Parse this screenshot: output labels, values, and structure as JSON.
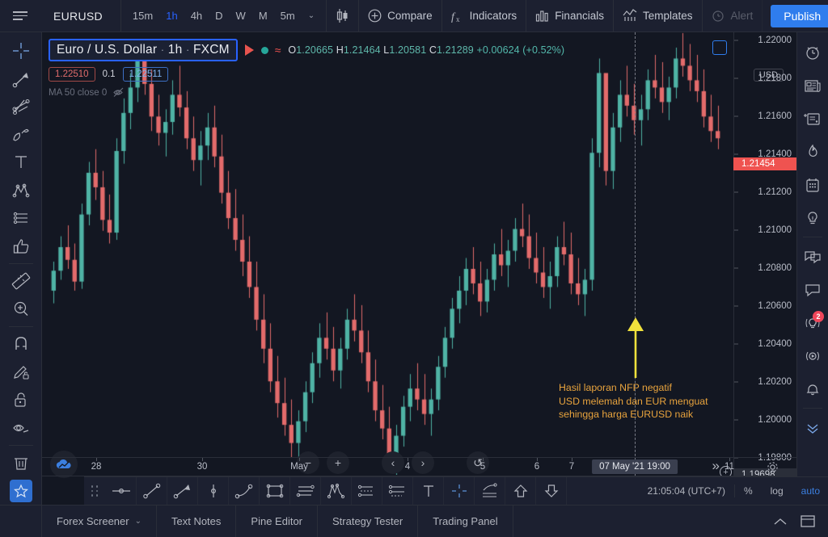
{
  "topbar": {
    "menu_icon": "hamburger-icon",
    "symbol": "EURUSD",
    "timeframes": [
      {
        "label": "15m",
        "active": false
      },
      {
        "label": "1h",
        "active": true
      },
      {
        "label": "4h",
        "active": false
      },
      {
        "label": "D",
        "active": false
      },
      {
        "label": "W",
        "active": false
      },
      {
        "label": "M",
        "active": false
      },
      {
        "label": "5m",
        "active": false
      }
    ],
    "caret": "⌄",
    "candle_style_icon": "candlestick-icon",
    "compare": "Compare",
    "indicators": "Indicators",
    "financials": "Financials",
    "templates": "Templates",
    "alert": "Alert",
    "publish": "Publish",
    "right_menu_icon": "list-menu-icon"
  },
  "legend": {
    "title_main": "Euro / U.S. Dollar",
    "title_sep1": "·",
    "title_tf": "1h",
    "title_sep2": "·",
    "title_exchange": "FXCM",
    "ohlc": "O1.20665  H1.21464  L1.20581  C1.21289  +0.00624 (+0.52%)",
    "o": "O",
    "o_val": "1.20665",
    "h": "H",
    "h_val": "1.21464",
    "l": "L",
    "l_val": "1.20581",
    "c": "C",
    "c_val": "1.21289",
    "change": "+0.00624 (+0.52%)",
    "pill_red": "1.22510",
    "mid_value": "0.1",
    "pill_blue": "1.22511",
    "ma_label": "MA 50 close 0",
    "eye_icon": "eye-hidden-icon"
  },
  "price_axis": {
    "currency": "USD",
    "labels": [
      "1.22000",
      "1.21800",
      "1.21600",
      "1.21400",
      "1.21200",
      "1.21000",
      "1.20800",
      "1.20600",
      "1.20400",
      "1.20200",
      "1.20000",
      "1.19800"
    ],
    "current_price": "1.21454",
    "last_price": "1.19698"
  },
  "time_axis": {
    "labels": [
      "28",
      "30",
      "May",
      "4",
      "5",
      "6",
      "7",
      "11"
    ],
    "crosshair_date": "07 May '21   19:00"
  },
  "annotation": {
    "line1": "Hasil laporan NFP negatif",
    "line2": "USD melemah dan EUR menguat",
    "line3": "sehingga harga EURUSD naik",
    "color": "#e8a33d",
    "arrow_color": "#f0e13c"
  },
  "chart_data": {
    "type": "candlestick",
    "title": "Euro / U.S. Dollar · 1h · FXCM",
    "symbol": "EURUSD",
    "timeframe": "1h",
    "exchange": "FXCM",
    "xlabel": "",
    "ylabel": "USD",
    "ylim": [
      1.19698,
      1.22
    ],
    "ytick_values": [
      1.22,
      1.218,
      1.216,
      1.214,
      1.212,
      1.21,
      1.208,
      1.206,
      1.204,
      1.202,
      1.2,
      1.198
    ],
    "xtick_labels": [
      "28",
      "30",
      "May",
      "4",
      "5",
      "6",
      "7",
      "11"
    ],
    "grid": false,
    "legend_position": "top-left",
    "up_color": "#4fb3a5",
    "down_color": "#e36b6b",
    "background": "#131722",
    "ohlc_last": {
      "open": 1.20665,
      "high": 1.21464,
      "low": 1.20581,
      "close": 1.21289,
      "change": 0.00624,
      "change_pct": 0.52
    },
    "series": [
      {
        "name": "EURUSD",
        "type": "candlestick",
        "ohlc": [
          [
            1.2062,
            1.2078,
            1.2055,
            1.2073
          ],
          [
            1.2073,
            1.2092,
            1.2068,
            1.2086
          ],
          [
            1.2086,
            1.2098,
            1.2074,
            1.2079
          ],
          [
            1.2079,
            1.2088,
            1.2062,
            1.2067
          ],
          [
            1.2067,
            1.211,
            1.2063,
            1.2104
          ],
          [
            1.2104,
            1.2133,
            1.2098,
            1.2127
          ],
          [
            1.2127,
            1.214,
            1.2112,
            1.2119
          ],
          [
            1.2119,
            1.2128,
            1.2095,
            1.2101
          ],
          [
            1.2101,
            1.2115,
            1.2088,
            1.2094
          ],
          [
            1.2094,
            1.2146,
            1.209,
            1.2139
          ],
          [
            1.2139,
            1.2168,
            1.2132,
            1.216
          ],
          [
            1.216,
            1.2182,
            1.2151,
            1.2174
          ],
          [
            1.2174,
            1.2196,
            1.2166,
            1.2189
          ],
          [
            1.2189,
            1.2198,
            1.217,
            1.2176
          ],
          [
            1.2176,
            1.2184,
            1.215,
            1.2158
          ],
          [
            1.2158,
            1.217,
            1.2142,
            1.2149
          ],
          [
            1.2149,
            1.2162,
            1.2136,
            1.2155
          ],
          [
            1.2155,
            1.2178,
            1.2148,
            1.217
          ],
          [
            1.217,
            1.2186,
            1.2158,
            1.2163
          ],
          [
            1.2163,
            1.2172,
            1.214,
            1.2146
          ],
          [
            1.2146,
            1.2158,
            1.2128,
            1.2134
          ],
          [
            1.2134,
            1.215,
            1.212,
            1.2142
          ],
          [
            1.2142,
            1.216,
            1.2134,
            1.2152
          ],
          [
            1.2152,
            1.2164,
            1.213,
            1.2136
          ],
          [
            1.2136,
            1.2148,
            1.211,
            1.2116
          ],
          [
            1.2116,
            1.2128,
            1.2096,
            1.2102
          ],
          [
            1.2102,
            1.2118,
            1.2084,
            1.209
          ],
          [
            1.209,
            1.2104,
            1.207,
            1.2078
          ],
          [
            1.2078,
            1.2092,
            1.2058,
            1.2064
          ],
          [
            1.2064,
            1.2078,
            1.204,
            1.2046
          ],
          [
            1.2046,
            1.206,
            1.2022,
            1.203
          ],
          [
            1.203,
            1.2044,
            1.2006,
            1.2012
          ],
          [
            1.2012,
            1.2026,
            1.1992,
            1.2
          ],
          [
            1.2,
            1.2014,
            1.1982,
            1.1988
          ],
          [
            1.1988,
            1.2002,
            1.197,
            1.1978
          ],
          [
            1.1978,
            1.1996,
            1.1966,
            1.199
          ],
          [
            1.199,
            1.2012,
            1.1984,
            1.2006
          ],
          [
            1.2006,
            1.2028,
            1.2,
            1.2022
          ],
          [
            1.2022,
            1.2044,
            1.2014,
            1.2036
          ],
          [
            1.2036,
            1.205,
            1.2024,
            1.203
          ],
          [
            1.203,
            1.2042,
            1.2012,
            1.2018
          ],
          [
            1.2018,
            1.2036,
            1.2008,
            1.203
          ],
          [
            1.203,
            1.2052,
            1.2024,
            1.2046
          ],
          [
            1.2046,
            1.206,
            1.2034,
            1.204
          ],
          [
            1.204,
            1.2054,
            1.2022,
            1.2028
          ],
          [
            1.2028,
            1.204,
            1.2006,
            1.2012
          ],
          [
            1.2012,
            1.2024,
            1.199,
            1.1996
          ],
          [
            1.1996,
            1.201,
            1.198,
            1.1986
          ],
          [
            1.1986,
            1.1998,
            1.1962,
            1.197
          ],
          [
            1.197,
            1.1988,
            1.1958,
            1.1982
          ],
          [
            1.1982,
            1.2004,
            1.1976,
            1.1998
          ],
          [
            1.1998,
            1.2016,
            1.199,
            1.2008
          ],
          [
            1.2008,
            1.2022,
            1.1996,
            1.2002
          ],
          [
            1.2002,
            1.2016,
            1.1988,
            1.1994
          ],
          [
            1.1994,
            1.2008,
            1.1982,
            1.2002
          ],
          [
            1.2002,
            1.2026,
            1.1996,
            1.202
          ],
          [
            1.202,
            1.2042,
            1.2014,
            1.2036
          ],
          [
            1.2036,
            1.2058,
            1.203,
            1.2052
          ],
          [
            1.2052,
            1.207,
            1.2044,
            1.2062
          ],
          [
            1.2062,
            1.208,
            1.2054,
            1.2074
          ],
          [
            1.2074,
            1.2086,
            1.206,
            1.2066
          ],
          [
            1.2066,
            1.2078,
            1.2048,
            1.2056
          ],
          [
            1.2056,
            1.2074,
            1.205,
            1.2068
          ],
          [
            1.2068,
            1.2088,
            1.2062,
            1.2082
          ],
          [
            1.2082,
            1.2096,
            1.207,
            1.2076
          ],
          [
            1.2076,
            1.209,
            1.2064,
            1.2084
          ],
          [
            1.2084,
            1.2102,
            1.2078,
            1.2096
          ],
          [
            1.2096,
            1.211,
            1.2086,
            1.2092
          ],
          [
            1.2092,
            1.2104,
            1.2074,
            1.208
          ],
          [
            1.208,
            1.2094,
            1.2066,
            1.2072
          ],
          [
            1.2072,
            1.2086,
            1.2058,
            1.2064
          ],
          [
            1.2064,
            1.2078,
            1.2052,
            1.207
          ],
          [
            1.207,
            1.2092,
            1.2064,
            1.2086
          ],
          [
            1.2086,
            1.21,
            1.2076,
            1.2082
          ],
          [
            1.2082,
            1.2094,
            1.206,
            1.2066
          ],
          [
            1.2066,
            1.208,
            1.2054,
            1.206
          ],
          [
            1.206,
            1.2074,
            1.2048,
            1.2068
          ],
          [
            1.2068,
            1.2146,
            1.2062,
            1.2138
          ],
          [
            1.2138,
            1.219,
            1.213,
            1.2182
          ],
          [
            1.2182,
            1.2164,
            1.212,
            1.2128
          ],
          [
            1.2128,
            1.216,
            1.2118,
            1.2152
          ],
          [
            1.2152,
            1.2178,
            1.2144,
            1.217
          ],
          [
            1.217,
            1.2186,
            1.2158,
            1.2164
          ],
          [
            1.2164,
            1.2176,
            1.2148,
            1.2156
          ],
          [
            1.2156,
            1.217,
            1.2142,
            1.2162
          ],
          [
            1.2162,
            1.2184,
            1.2156,
            1.2178
          ],
          [
            1.2178,
            1.2192,
            1.2168,
            1.2174
          ],
          [
            1.2174,
            1.2188,
            1.216,
            1.2166
          ],
          [
            1.2166,
            1.218,
            1.2156,
            1.2174
          ],
          [
            1.2174,
            1.2196,
            1.2168,
            1.219
          ],
          [
            1.219,
            1.2204,
            1.218,
            1.2186
          ],
          [
            1.2186,
            1.2198,
            1.2172,
            1.2178
          ],
          [
            1.2178,
            1.2192,
            1.2166,
            1.2172
          ],
          [
            1.2172,
            1.2184,
            1.2152,
            1.2158
          ],
          [
            1.2158,
            1.217,
            1.2144,
            1.215
          ],
          [
            1.215,
            1.2164,
            1.214,
            1.2146
          ]
        ]
      }
    ]
  },
  "nav_controls": {
    "zoom_out": "−",
    "zoom_in": "+",
    "scroll_left": "‹",
    "scroll_right": "›",
    "reset": "↺",
    "fast_forward": "»"
  },
  "status_bar": {
    "time": "21:05:04 (UTC+7)",
    "percent": "%",
    "log": "log",
    "auto": "auto"
  },
  "bottom_tabs": [
    {
      "label": "Forex Screener",
      "caret": "⌄"
    },
    {
      "label": "Text Notes",
      "caret": ""
    },
    {
      "label": "Pine Editor",
      "caret": ""
    },
    {
      "label": "Strategy Tester",
      "caret": ""
    },
    {
      "label": "Trading Panel",
      "caret": ""
    }
  ],
  "left_tools": [
    {
      "name": "crosshair-icon",
      "active": true
    },
    {
      "name": "trend-line-icon",
      "active": false
    },
    {
      "name": "pitchfork-icon",
      "active": false
    },
    {
      "name": "brush-icon",
      "active": false
    },
    {
      "name": "text-tool-icon",
      "active": false
    },
    {
      "name": "patterns-icon",
      "active": false
    },
    {
      "name": "prediction-icon",
      "active": false
    },
    {
      "name": "thumbs-up-icon",
      "active": false
    },
    {
      "name": "ruler-icon",
      "active": false
    },
    {
      "name": "zoom-in-icon",
      "active": false
    },
    {
      "name": "magnet-icon",
      "active": false
    },
    {
      "name": "drawing-lock-icon",
      "active": false
    },
    {
      "name": "lock-icon",
      "active": false
    },
    {
      "name": "eye-icon",
      "active": false
    },
    {
      "name": "trash-icon",
      "active": false
    },
    {
      "name": "favorites-star-icon",
      "active": true
    }
  ],
  "right_tools": [
    {
      "name": "alarm-clock-icon",
      "badge": ""
    },
    {
      "name": "news-icon",
      "badge": ""
    },
    {
      "name": "watchlist-icon",
      "badge": ""
    },
    {
      "name": "hotlist-fire-icon",
      "badge": ""
    },
    {
      "name": "calendar-icon",
      "badge": ""
    },
    {
      "name": "ideas-bulb-icon",
      "badge": ""
    },
    {
      "name": "chats-icon",
      "badge": ""
    },
    {
      "name": "chat-single-icon",
      "badge": ""
    },
    {
      "name": "ideas-stream-icon",
      "badge": "2"
    },
    {
      "name": "broadcast-icon",
      "badge": ""
    },
    {
      "name": "notifications-bell-icon",
      "badge": ""
    },
    {
      "name": "collapse-chevrons-icon",
      "badge": ""
    }
  ],
  "draw_tools": [
    "grip-handle-icon",
    "horizontal-line-icon",
    "trend-line-icon",
    "arrow-line-icon",
    "vertical-line-icon",
    "curve-icon",
    "rectangle-icon",
    "parallel-channel-icon",
    "elliott-wave-icon",
    "fib-retracement-icon",
    "fib-extension-icon",
    "text-icon",
    "crosshair-icon",
    "pattern-lines-icon",
    "long-position-icon",
    "short-position-icon"
  ]
}
